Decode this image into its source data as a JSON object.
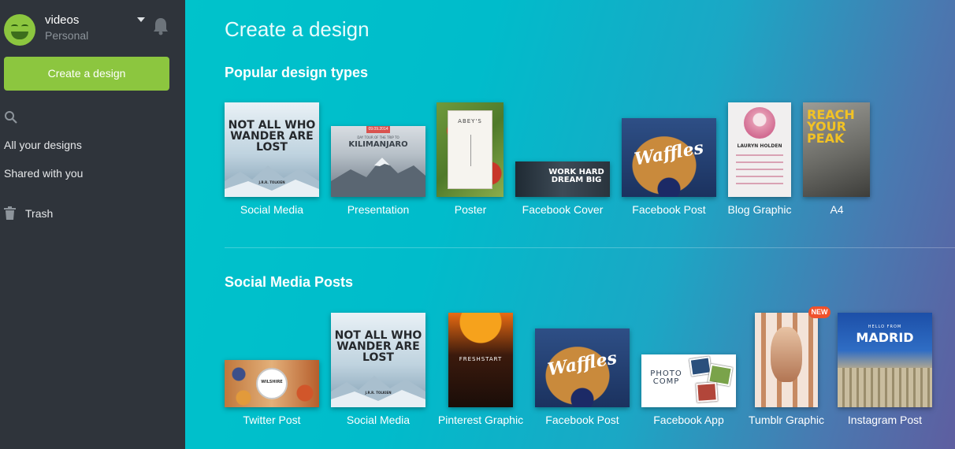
{
  "account": {
    "name": "videos",
    "plan": "Personal"
  },
  "sidebar": {
    "create_label": "Create a design",
    "items": [
      {
        "label": "All your designs"
      },
      {
        "label": "Shared with you"
      },
      {
        "label": "Trash"
      }
    ]
  },
  "main": {
    "title": "Create a design",
    "sections": [
      {
        "title": "Popular design types",
        "items": [
          {
            "label": "Social Media",
            "thumb_text": "NOT ALL WHO WANDER ARE LOST",
            "thumb_credit": "J.R.R. TOLKIEN"
          },
          {
            "label": "Presentation",
            "thumb_text": "KILIMANJARO",
            "thumb_sub": "DAY TOUR OF THE TRIP TO",
            "thumb_ribbon": "09.09.2014"
          },
          {
            "label": "Poster",
            "thumb_text": "ABEY'S"
          },
          {
            "label": "Facebook Cover",
            "thumb_text": "WORK HARD DREAM BIG"
          },
          {
            "label": "Facebook Post",
            "thumb_text": "Waffles"
          },
          {
            "label": "Blog Graphic",
            "thumb_text": "LAURYN HOLDEN"
          },
          {
            "label": "A4",
            "thumb_text": "REACH YOUR PEAK"
          }
        ]
      },
      {
        "title": "Social Media Posts",
        "items": [
          {
            "label": "Twitter Post",
            "thumb_text": "WILSHIRE"
          },
          {
            "label": "Social Media",
            "thumb_text": "NOT ALL WHO WANDER ARE LOST",
            "thumb_credit": "J.R.R. TOLKIEN"
          },
          {
            "label": "Pinterest Graphic",
            "thumb_text": "FRESHSTART"
          },
          {
            "label": "Facebook Post",
            "thumb_text": "Waffles"
          },
          {
            "label": "Facebook App",
            "thumb_text": "PHOTO COMP"
          },
          {
            "label": "Tumblr Graphic",
            "badge": "NEW"
          },
          {
            "label": "Instagram Post",
            "thumb_text": "MADRID",
            "thumb_sub": "HELLO FROM"
          }
        ]
      }
    ]
  },
  "colors": {
    "sidebar": "#2f343b",
    "accent_green": "#8cc63f",
    "main_start": "#00c3cb",
    "main_end": "#5e5ea0",
    "new_badge": "#f0512b"
  },
  "icons": [
    "bell-icon",
    "search-icon",
    "trash-icon",
    "chevron-down-icon"
  ]
}
